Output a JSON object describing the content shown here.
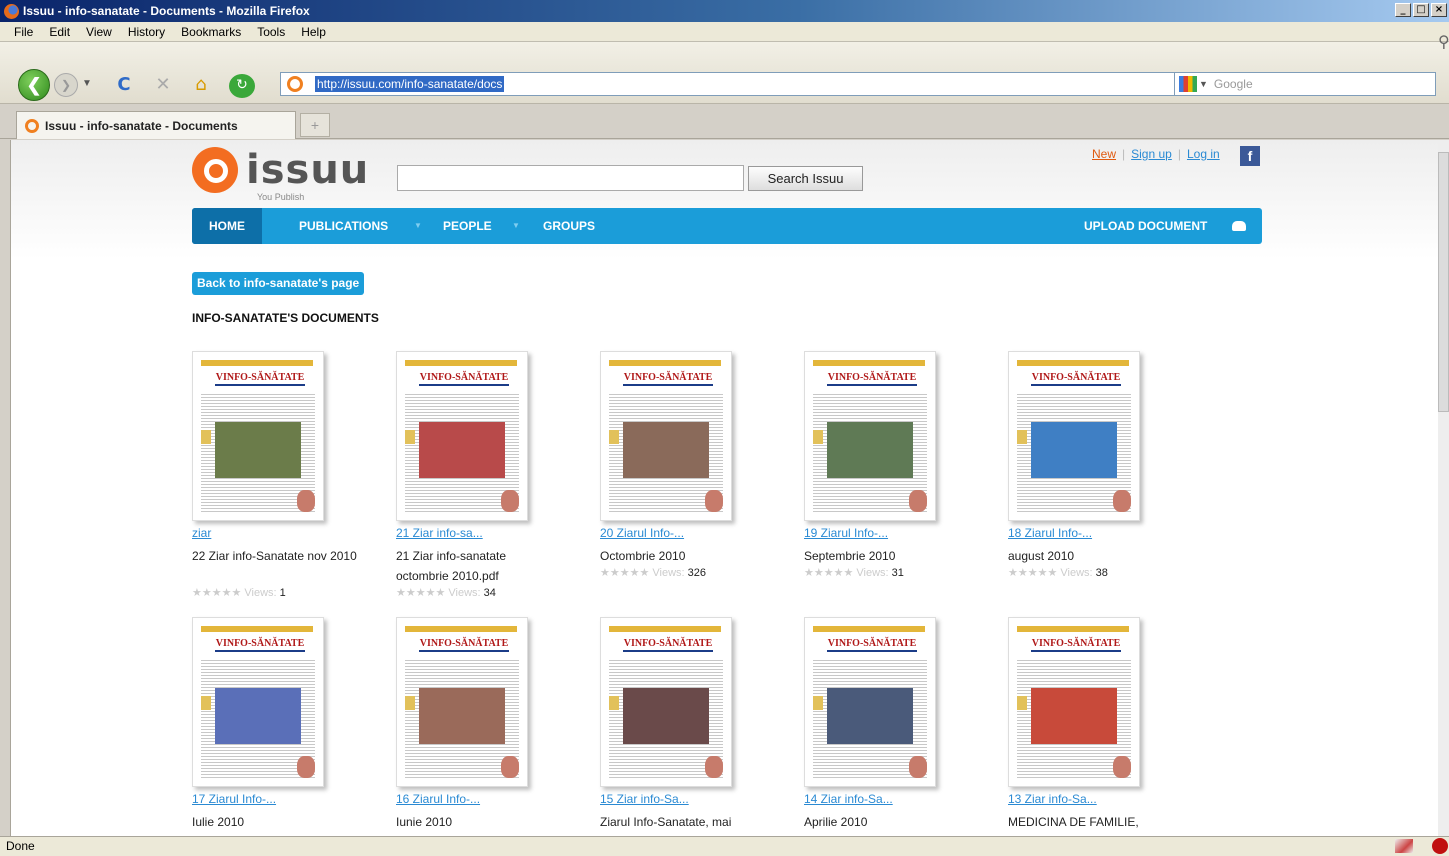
{
  "window": {
    "title": "Issuu - info-sanatate - Documents - Mozilla Firefox",
    "controls": [
      "_",
      "□",
      "×"
    ]
  },
  "menu": [
    "File",
    "Edit",
    "View",
    "History",
    "Bookmarks",
    "Tools",
    "Help"
  ],
  "toolbar": {
    "url": "http://issuu.com/info-sanatate/docs",
    "search_placeholder": "Google"
  },
  "tabs": [
    {
      "label": "Issuu - info-sanatate - Documents"
    }
  ],
  "page": {
    "logo_text": "issuu",
    "logo_tag": "You Publish",
    "search_button": "Search Issuu",
    "top_links": {
      "new": "New",
      "signup": "Sign up",
      "login": "Log in"
    },
    "nav": {
      "home": "HOME",
      "publications": "PUBLICATIONS",
      "people": "PEOPLE",
      "groups": "GROUPS",
      "upload": "UPLOAD DOCUMENT"
    },
    "back_link": "Back to info-sanatate's page",
    "section_title": "INFO-SANATATE'S DOCUMENTS",
    "views_label": "Views:",
    "stars": "★★★★★",
    "documents": [
      {
        "title": "ziar",
        "desc": "22 Ziar info-Sanatate nov 2010",
        "views": "1",
        "photo_color": "#6b7c4a"
      },
      {
        "title": "21 Ziar info-sa...",
        "desc": "21 Ziar info-sanatate octombrie 2010.pdf",
        "views": "34",
        "photo_color": "#b84a4a"
      },
      {
        "title": "20 Ziarul Info-...",
        "desc": "Octombrie 2010",
        "views": "326",
        "photo_color": "#8a6a5a"
      },
      {
        "title": "19 Ziarul Info-...",
        "desc": "Septembrie 2010",
        "views": "31",
        "photo_color": "#5f7a55"
      },
      {
        "title": "18 Ziarul Info-...",
        "desc": "august 2010",
        "views": "38",
        "photo_color": "#3f7fc4"
      },
      {
        "title": "17 Ziarul Info-...",
        "desc": "Iulie 2010",
        "views": "",
        "photo_color": "#5a6fb8"
      },
      {
        "title": "16 Ziarul Info-...",
        "desc": "Iunie 2010",
        "views": "",
        "photo_color": "#9a6a5a"
      },
      {
        "title": "15 Ziar info-Sa...",
        "desc": "Ziarul Info-Sanatate, mai",
        "views": "",
        "photo_color": "#6a4a4a"
      },
      {
        "title": "14 Ziar info-Sa...",
        "desc": "Aprilie 2010",
        "views": "",
        "photo_color": "#4a5a7a"
      },
      {
        "title": "13 Ziar info-Sa...",
        "desc": "MEDICINA DE FAMILIE,",
        "views": "",
        "photo_color": "#c84a3a"
      }
    ],
    "masthead": "VINFO-SĂNĂTATE"
  },
  "status": "Done"
}
